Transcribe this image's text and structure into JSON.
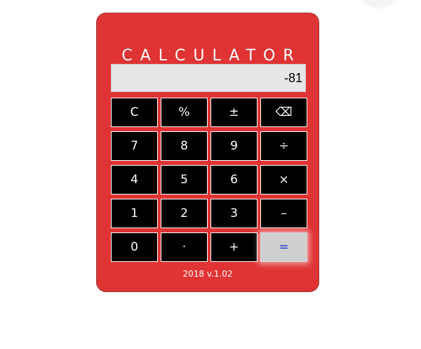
{
  "calculator": {
    "title": "CALCULATOR",
    "display_value": "-81",
    "version": "2018 v.1.02",
    "keys": [
      {
        "name": "clear-button",
        "label": "C"
      },
      {
        "name": "percent-button",
        "label": "%"
      },
      {
        "name": "plus-minus-button",
        "label": "±"
      },
      {
        "name": "backspace-button",
        "label": "⌫"
      },
      {
        "name": "digit-7-button",
        "label": "7"
      },
      {
        "name": "digit-8-button",
        "label": "8"
      },
      {
        "name": "digit-9-button",
        "label": "9"
      },
      {
        "name": "divide-button",
        "label": "÷"
      },
      {
        "name": "digit-4-button",
        "label": "4"
      },
      {
        "name": "digit-5-button",
        "label": "5"
      },
      {
        "name": "digit-6-button",
        "label": "6"
      },
      {
        "name": "multiply-button",
        "label": "×"
      },
      {
        "name": "digit-1-button",
        "label": "1"
      },
      {
        "name": "digit-2-button",
        "label": "2"
      },
      {
        "name": "digit-3-button",
        "label": "3"
      },
      {
        "name": "subtract-button",
        "label": "–"
      },
      {
        "name": "digit-0-button",
        "label": "0"
      },
      {
        "name": "decimal-button",
        "label": "·"
      },
      {
        "name": "add-button",
        "label": "+"
      },
      {
        "name": "equals-button",
        "label": "="
      }
    ]
  },
  "colors": {
    "body": "#e03333",
    "display_bg": "#e6e6e6",
    "key_bg": "#000000",
    "key_text": "#ffffff",
    "equals_bg": "#cfcfcf",
    "equals_text": "#2233dd"
  }
}
